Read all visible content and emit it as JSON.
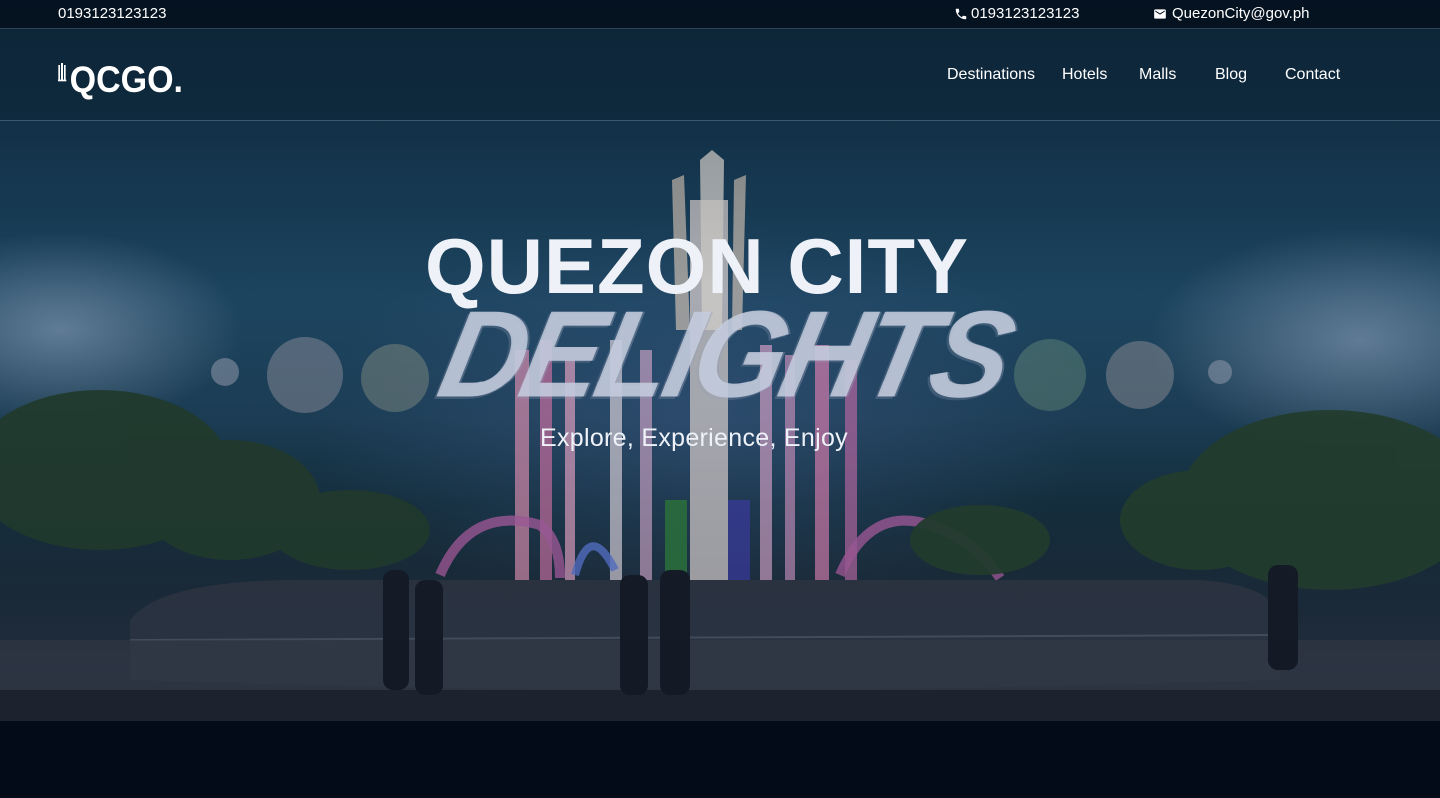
{
  "topbar": {
    "phone_left": "0193123123123",
    "phone": "0193123123123",
    "email": "QuezonCity@gov.ph",
    "phone_icon": "phone-icon",
    "email_icon": "mail-icon"
  },
  "brand": {
    "name": "QCGO.",
    "logo_icon": "monument-icon"
  },
  "nav": {
    "items": [
      "Destinations",
      "Hotels",
      "Malls",
      "Blog",
      "Contact"
    ]
  },
  "hero": {
    "title_line1": "QUEZON CITY",
    "title_line2": "DELIGHTS",
    "subtitle": "Explore, Experience, Enjoy"
  },
  "colors": {
    "topbar_bg": "#04111f",
    "text": "#ffffff",
    "page_bg": "#030a18"
  }
}
